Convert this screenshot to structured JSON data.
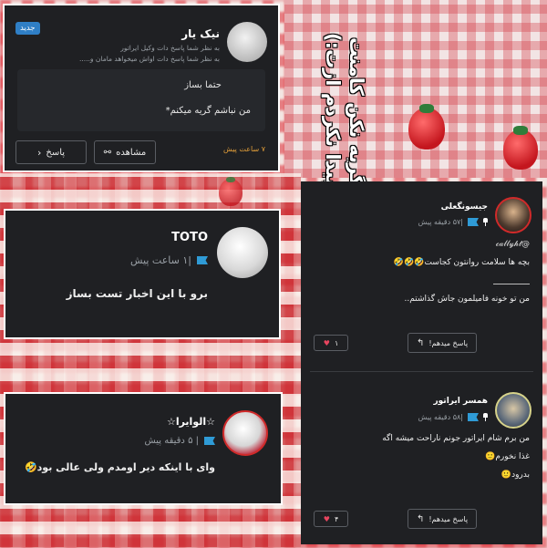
{
  "overlay_title": [
    "گریه نکن کامنت",
    "پیدا نکردم ازت:)"
  ],
  "card1": {
    "author": "نیک یار",
    "badge": "جدید",
    "reply_line_1": "به نظر شما پاسخ دات وکیل ایراتور",
    "reply_line_2": "به نظر شما پاسخ دات اواش میخواهد مامان و.....",
    "quote_line_1": "حتما بساز",
    "quote_line_2": "من نباشم گریه میکنم*",
    "time": "۷ ساعت پیش",
    "view_label": "مشاهده",
    "reply_label": "پاسخ"
  },
  "card2": {
    "author": "TOTO",
    "time": "|۱ ساعت پیش",
    "text": "برو با این اخبار تست بساز"
  },
  "card3": {
    "author": "☆الوایرا☆",
    "time": "| ۵ دقیقه پیش",
    "text": "وای با اینکه دیر اومدم ولی عالی بود🤣"
  },
  "card4": {
    "comment1": {
      "author": "جیسونگعلی",
      "time": "|۵۷ دقیقه پیش",
      "mention": "@𝒸𝒶𝓁𝓁𝓎𝒽𝓉",
      "line1": "بچه ها سلامت روانتون کجاست🤣🤣🤣",
      "line2": "من تو خونه فامیلمون جاش گذاشتم..",
      "likes": "۱",
      "reply_label": "پاسخ میدهم!"
    },
    "comment2": {
      "author": "همسر ایراتور",
      "time": "|۵۸ دقیقه پیش",
      "line1": "من برم شام ایراتور جونم ناراحت میشه اگه",
      "line2": "غذا نخورم🙂",
      "line3": "بدرود🙂",
      "likes": "۴",
      "reply_label": "پاسخ میدهم!"
    }
  },
  "colors": {
    "card_bg": "#1f2023",
    "badge": "#2f7fc6",
    "flag": "#2f9bd6",
    "time_orange": "#e8a23a",
    "heart": "#e8455f"
  }
}
